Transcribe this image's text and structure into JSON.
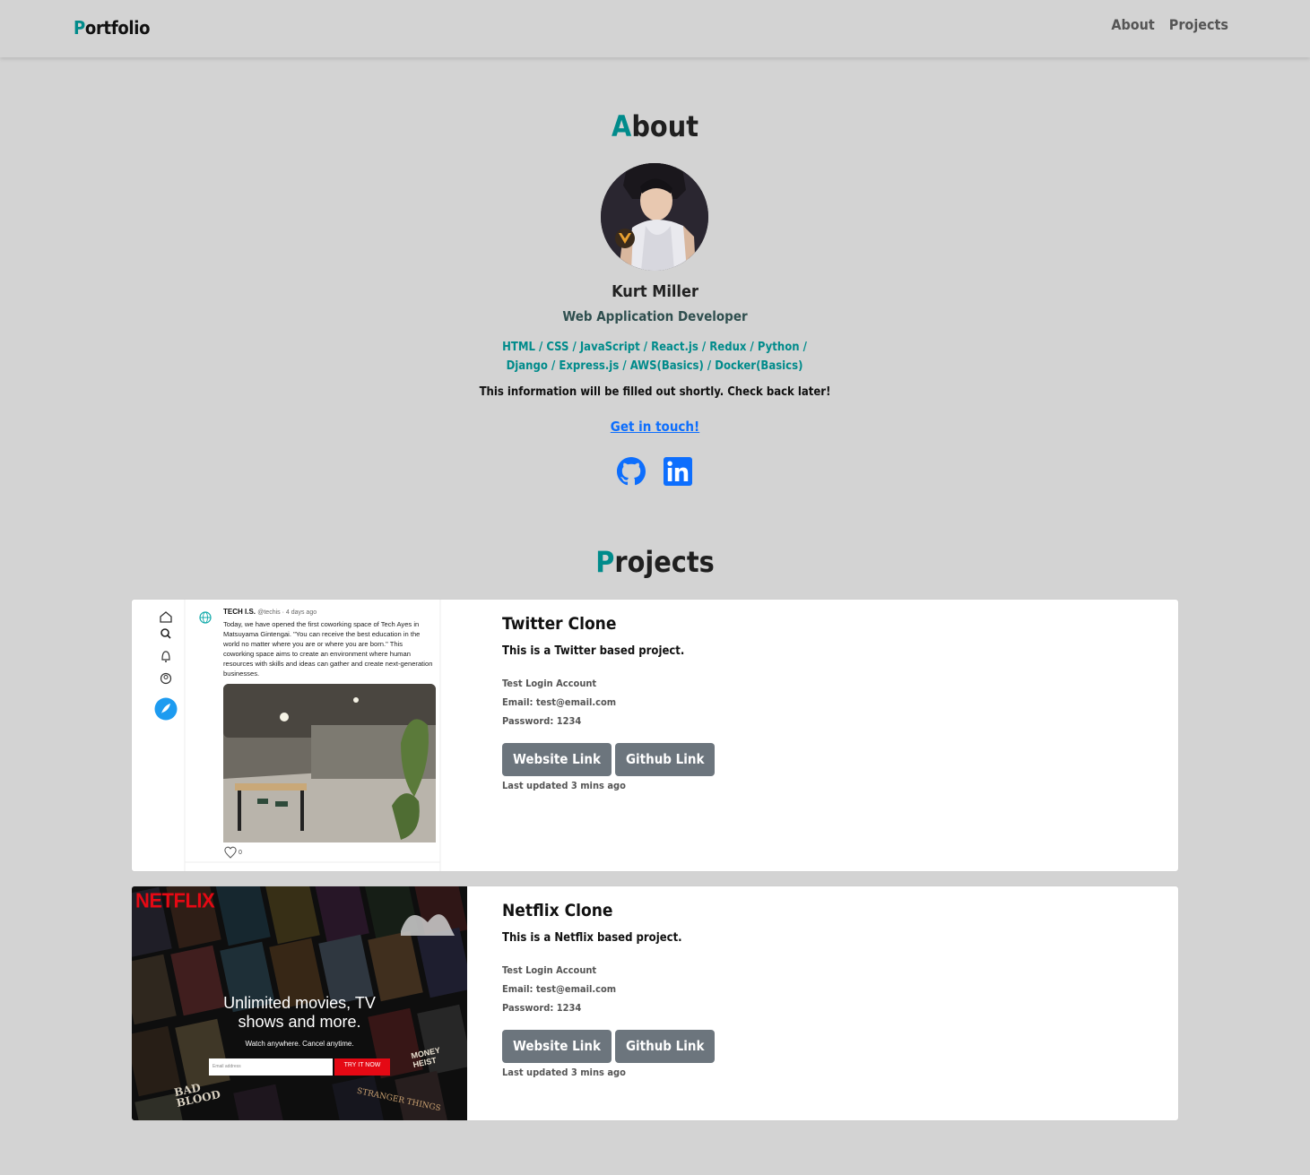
{
  "nav": {
    "brand_first": "P",
    "brand_rest": "ortfolio",
    "links": [
      "About",
      "Projects"
    ]
  },
  "about": {
    "title_first": "A",
    "title_rest": "bout",
    "name": "Kurt Miller",
    "role": "Web Application Developer",
    "skills": "HTML / CSS / JavaScript / React.js / Redux / Python / Django / Express.js / AWS(Basics) / Docker(Basics)",
    "info": "This information will be filled out shortly. Check back later!",
    "contact_label": "Get in touch!",
    "socials": [
      "github-icon",
      "linkedin-icon"
    ]
  },
  "projects": {
    "title_first": "P",
    "title_rest": "rojects",
    "items": [
      {
        "title": "Twitter Clone",
        "description": "This is a Twitter based project.",
        "login_heading": "Test Login Account",
        "email": "Email: test@email.com",
        "password": "Password: 1234",
        "website_label": "Website Link",
        "github_label": "Github Link",
        "updated": "Last updated 3 mins ago",
        "preview": {
          "user": "TECH I.S.",
          "handle": "@techis · 4 days ago",
          "text": "Today, we have opened the first coworking space of Tech Ayes in Matsuyama Gintengai. \"You can receive the best education in the world no matter where you are or where you are born.\" This coworking space aims to create an environment where human resources with skills and ideas can gather and create next-generation businesses.",
          "likes": "0"
        }
      },
      {
        "title": "Netflix Clone",
        "description": "This is a Netflix based project.",
        "login_heading": "Test Login Account",
        "email": "Email: test@email.com",
        "password": "Password: 1234",
        "website_label": "Website Link",
        "github_label": "Github Link",
        "updated": "Last updated 3 mins ago",
        "preview": {
          "logo": "NETFLIX",
          "headline_1": "Unlimited movies, TV",
          "headline_2": "shows and more.",
          "sub": "Watch anywhere. Cancel anytime.",
          "input_placeholder": "Email address",
          "cta": "TRY IT NOW",
          "poster_1": "BAD BLOOD",
          "poster_2": "MONEY HEIST",
          "poster_3": "STRANGER THINGS"
        }
      }
    ]
  },
  "colors": {
    "accent": "#008b8b",
    "background": "#d3d3d3",
    "link": "#0d6efd",
    "button": "#6c757d"
  }
}
